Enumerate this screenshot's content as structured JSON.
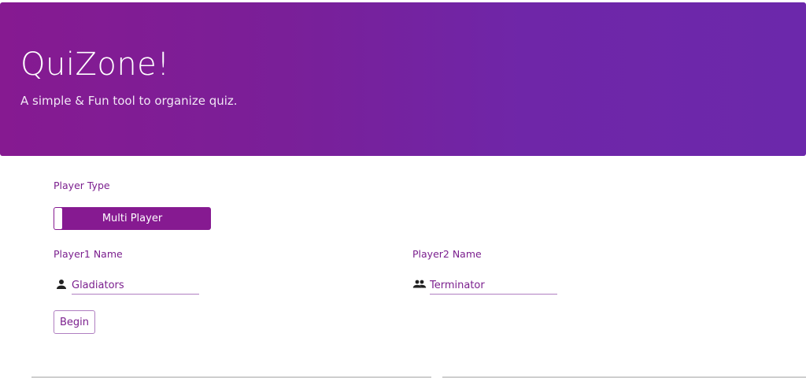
{
  "header": {
    "title": "QuiZone!",
    "subtitle": "A simple & Fun tool to organize quiz."
  },
  "form": {
    "player_type_label": "Player Type",
    "player_type_toggle": "Multi Player",
    "player1": {
      "label": "Player1 Name",
      "value": "Gladiators",
      "icon": "person-icon"
    },
    "player2": {
      "label": "Player2 Name",
      "value": "Terminator",
      "icon": "people-icon"
    },
    "begin_label": "Begin"
  },
  "colors": {
    "accent": "#861a91",
    "header_gradient_start": "#861a91",
    "header_gradient_end": "#6c28ab",
    "label_text": "#7b1f8e"
  }
}
